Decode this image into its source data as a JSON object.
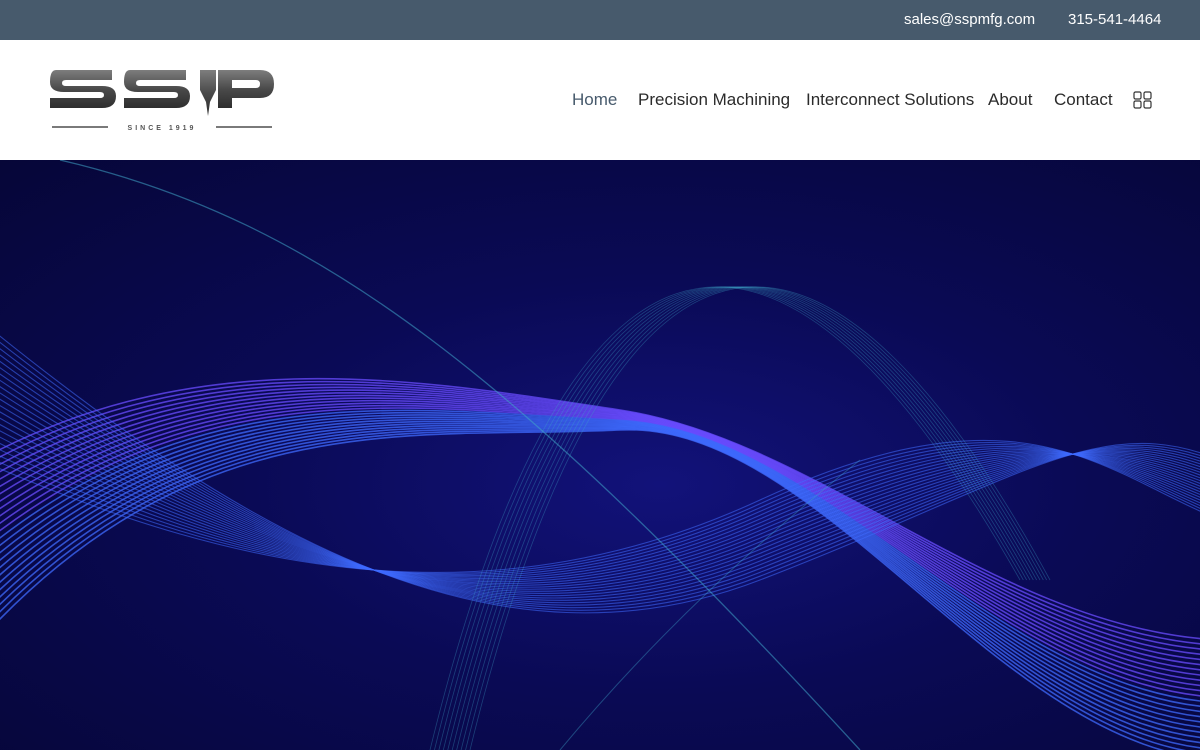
{
  "topbar": {
    "email": "sales@sspmfg.com",
    "phone": "315-541-4464"
  },
  "logo": {
    "brand": "SSP",
    "tagline": "SINCE 1919"
  },
  "nav": {
    "items": [
      {
        "label": "Home",
        "active": true
      },
      {
        "label": "Precision Machining"
      },
      {
        "label": "Interconnect Solutions"
      },
      {
        "label": "About"
      },
      {
        "label": "Contact"
      }
    ],
    "menu_icon": "grid-menu-icon"
  },
  "colors": {
    "topbar_bg": "#475a6c",
    "nav_active": "#475a6c",
    "nav_text": "#2b2b2b",
    "hero_bg": "#0a0a55",
    "wave_violet": "#6a4cff",
    "wave_blue": "#3f6bff",
    "wave_teal": "#3fa6c8"
  },
  "hero": {
    "background": "abstract-wave-lines"
  }
}
